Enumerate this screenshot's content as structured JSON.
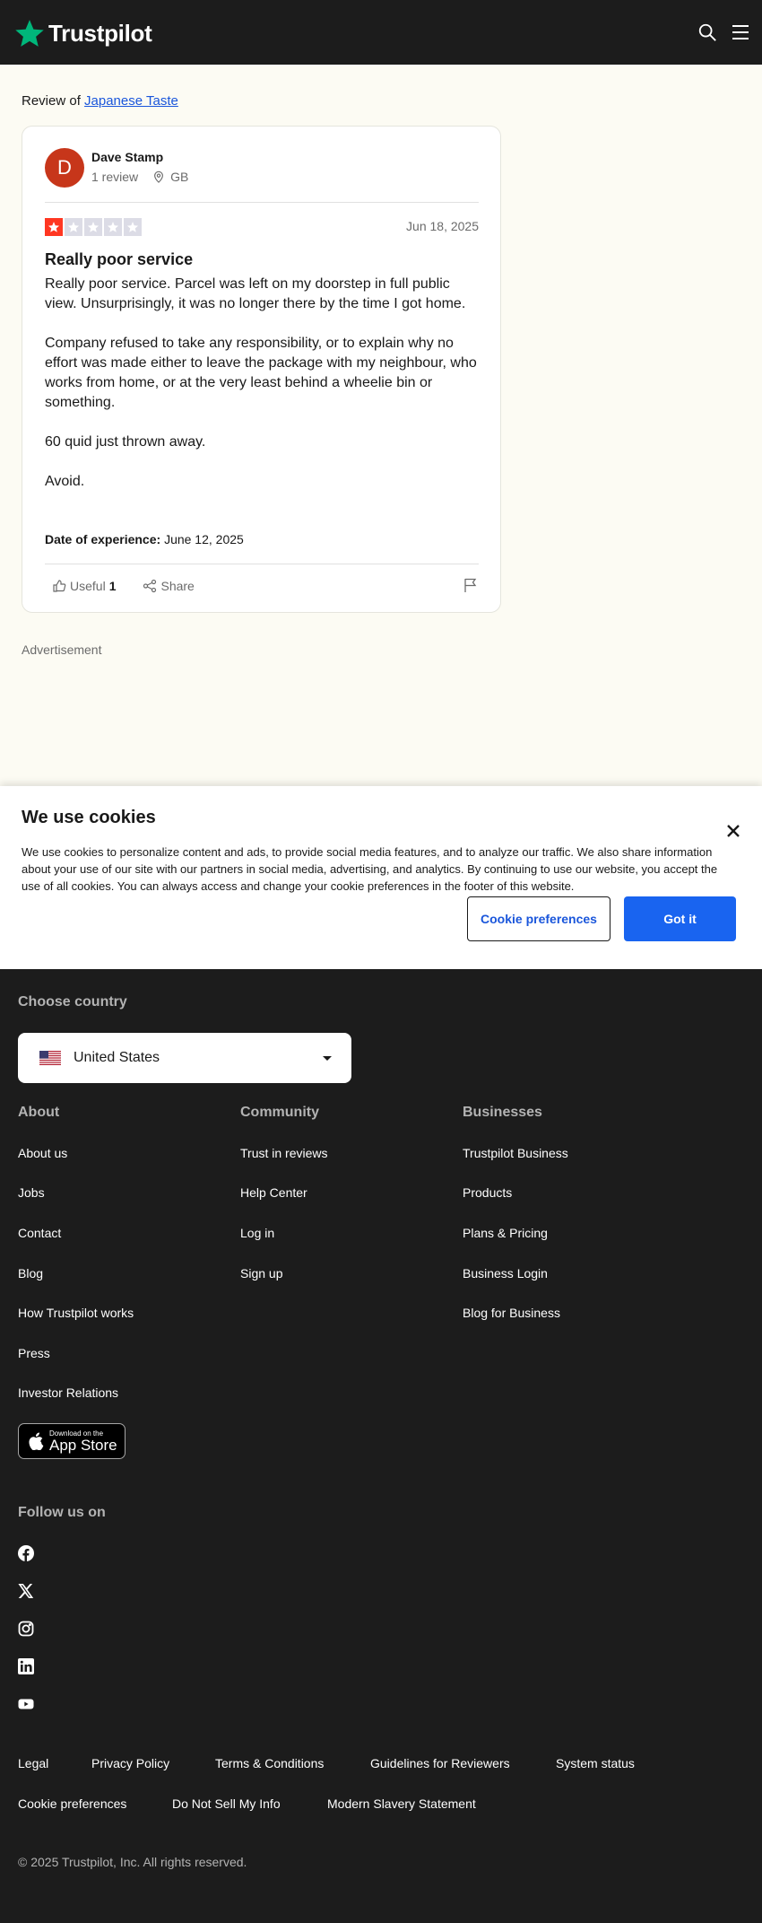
{
  "header": {
    "brand": "Trustpilot",
    "search_icon": "search-icon",
    "menu_icon": "hamburger-menu-icon"
  },
  "review_of": {
    "prefix": "Review of",
    "business": "Japanese Taste"
  },
  "review": {
    "avatar_initial": "D",
    "reviewer_name": "Dave Stamp",
    "review_count": "1 review",
    "country": "GB",
    "rating": 1,
    "max_rating": 5,
    "date": "Jun 18, 2025",
    "title": "Really poor service",
    "paragraphs": [
      "Really poor service. Parcel was left on my doorstep in full public view. Unsurprisingly, it was no longer there by the time I got home.",
      "Company refused to take any responsibility, or to explain why no effort was made either to leave the package with my neighbour, who works from home, or at the very least behind a wheelie bin or something.",
      "60 quid just thrown away.",
      "Avoid."
    ],
    "experience_label": "Date of experience:",
    "experience_date": "June 12, 2025",
    "useful_label": "Useful",
    "useful_count": "1",
    "share_label": "Share"
  },
  "ad_label": "Advertisement",
  "cookie_banner": {
    "title": "We use cookies",
    "text": "We use cookies to personalize content and ads, to provide social media features, and to analyze our traffic. We also share information about your use of our site with our partners in social media, advertising, and analytics. By continuing to use our website, you accept the use of all cookies. You can always access and change your cookie preferences in the footer of this website.",
    "preferences_button": "Cookie preferences",
    "accept_button": "Got it"
  },
  "footer": {
    "choose_country": "Choose country",
    "selected_country": "United States",
    "columns": {
      "about": {
        "heading": "About",
        "links": [
          "About us",
          "Jobs",
          "Contact",
          "Blog",
          "How Trustpilot works",
          "Press",
          "Investor Relations"
        ]
      },
      "community": {
        "heading": "Community",
        "links": [
          "Trust in reviews",
          "Help Center",
          "Log in",
          "Sign up"
        ]
      },
      "businesses": {
        "heading": "Businesses",
        "links": [
          "Trustpilot Business",
          "Products",
          "Plans & Pricing",
          "Business Login",
          "Blog for Business"
        ]
      }
    },
    "app_store": {
      "small": "Download on the",
      "big": "App Store"
    },
    "follow_us": "Follow us on",
    "social_icons": [
      "facebook-icon",
      "x-icon",
      "instagram-icon",
      "linkedin-icon",
      "youtube-icon"
    ],
    "bottom_links": [
      "Legal",
      "Privacy Policy",
      "Terms & Conditions",
      "Guidelines for Reviewers",
      "System status",
      "Cookie preferences",
      "Do Not Sell My Info",
      "Modern Slavery Statement"
    ],
    "copyright": "© 2025 Trustpilot, Inc. All rights reserved."
  },
  "colors": {
    "brand_green": "#00b67a",
    "one_star_red": "#ff3722",
    "empty_star": "#dcdce6",
    "link_blue": "#1a56db",
    "button_blue": "#1964f0",
    "avatar": "#c7361a"
  }
}
